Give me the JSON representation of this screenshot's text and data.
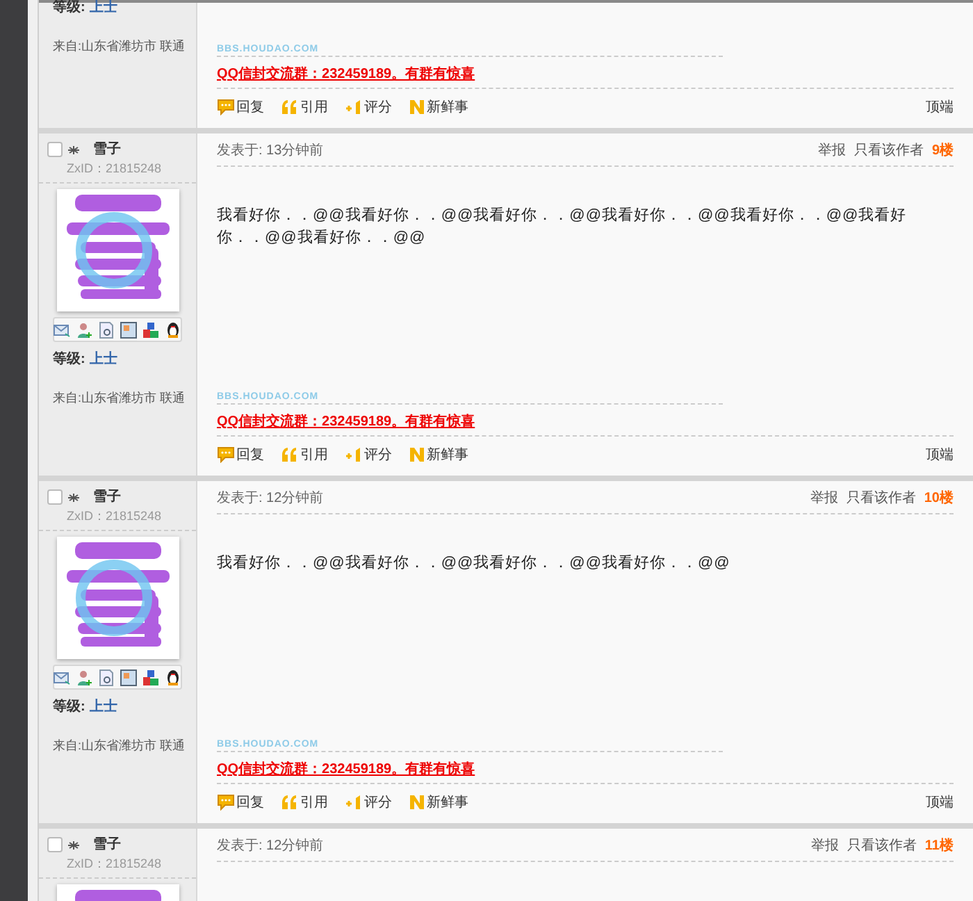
{
  "top_fragment": {
    "level_label": "等级:",
    "level": "上士",
    "from": "来自:山东省潍坊市 联通",
    "site_logo": "BBS.HOUDAO.COM",
    "signature": "QQ信封交流群：232459189。有群有惊喜",
    "actions": [
      {
        "kind": "reply",
        "label": "回复"
      },
      {
        "kind": "quote",
        "label": "引用"
      },
      {
        "kind": "rate",
        "label": "评分"
      },
      {
        "kind": "news",
        "label": "新鲜事"
      }
    ],
    "top_link": "顶端"
  },
  "posts": [
    {
      "username": "雪子",
      "user_id": "ZxID：21815248",
      "posted": "发表于: 13分钟前",
      "report": "举报",
      "author_only": "只看该作者",
      "floor": "9楼",
      "content": "我看好你．．@@我看好你．．@@我看好你．．@@我看好你．．@@我看好你．．@@我看好你．．@@我看好你．．@@",
      "level_label": "等级:",
      "level": "上士",
      "from": "来自:山东省潍坊市 联通",
      "site_logo": "BBS.HOUDAO.COM",
      "signature": "QQ信封交流群：232459189。有群有惊喜",
      "actions": [
        {
          "kind": "reply",
          "label": "回复"
        },
        {
          "kind": "quote",
          "label": "引用"
        },
        {
          "kind": "rate",
          "label": "评分"
        },
        {
          "kind": "news",
          "label": "新鲜事"
        }
      ],
      "top_link": "顶端"
    },
    {
      "username": "雪子",
      "user_id": "ZxID：21815248",
      "posted": "发表于: 12分钟前",
      "report": "举报",
      "author_only": "只看该作者",
      "floor": "10楼",
      "content": "我看好你．．@@我看好你．．@@我看好你．．@@我看好你．．@@",
      "level_label": "等级:",
      "level": "上士",
      "from": "来自:山东省潍坊市 联通",
      "site_logo": "BBS.HOUDAO.COM",
      "signature": "QQ信封交流群：232459189。有群有惊喜",
      "actions": [
        {
          "kind": "reply",
          "label": "回复"
        },
        {
          "kind": "quote",
          "label": "引用"
        },
        {
          "kind": "rate",
          "label": "评分"
        },
        {
          "kind": "news",
          "label": "新鲜事"
        }
      ],
      "top_link": "顶端"
    },
    {
      "username": "雪子",
      "user_id": "ZxID：21815248",
      "posted": "发表于: 12分钟前",
      "report": "举报",
      "author_only": "只看该作者",
      "floor": "11楼"
    }
  ]
}
